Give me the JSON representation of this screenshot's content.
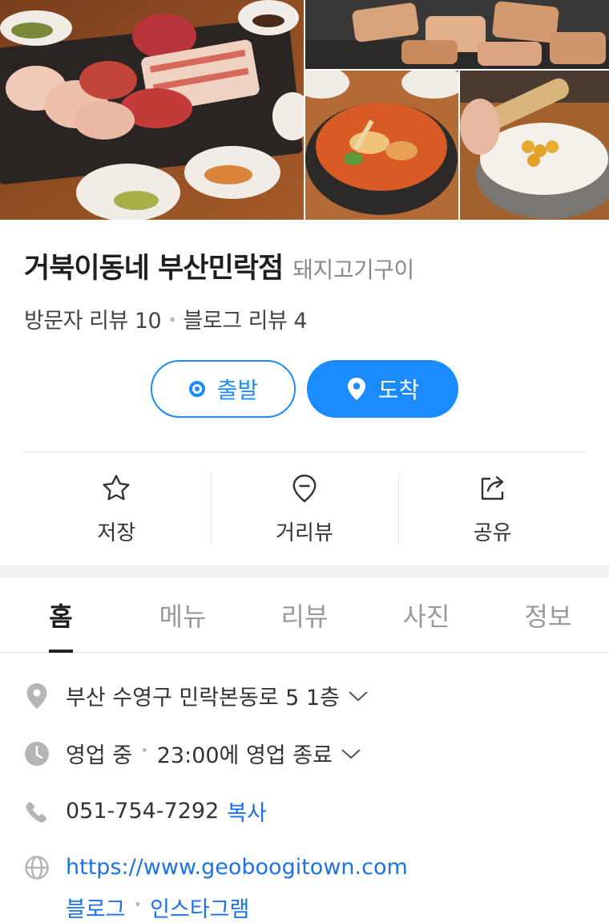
{
  "place": {
    "name": "거북이동네 부산민락점",
    "category": "돼지고기구이",
    "visitor_reviews": "방문자 리뷰 10",
    "blog_reviews": "블로그 리뷰 4"
  },
  "route": {
    "depart_label": "출발",
    "arrive_label": "도착"
  },
  "actions": [
    {
      "label": "저장",
      "icon": "star-icon"
    },
    {
      "label": "거리뷰",
      "icon": "street-view-pin-icon"
    },
    {
      "label": "공유",
      "icon": "share-icon"
    }
  ],
  "tabs": [
    {
      "label": "홈",
      "active": true
    },
    {
      "label": "메뉴"
    },
    {
      "label": "리뷰"
    },
    {
      "label": "사진"
    },
    {
      "label": "정보"
    }
  ],
  "info": {
    "address": "부산 수영구 민락본동로 5 1층",
    "hours_status": "영업 중",
    "hours_detail": "23:00에 영업 종료",
    "phone": "051-754-7292",
    "copy_label": "복사",
    "website": "https://www.geoboogitown.com",
    "links": [
      "블로그",
      "인스타그램"
    ]
  },
  "colors": {
    "accent": "#1a8cff",
    "link": "#1a73e8"
  }
}
